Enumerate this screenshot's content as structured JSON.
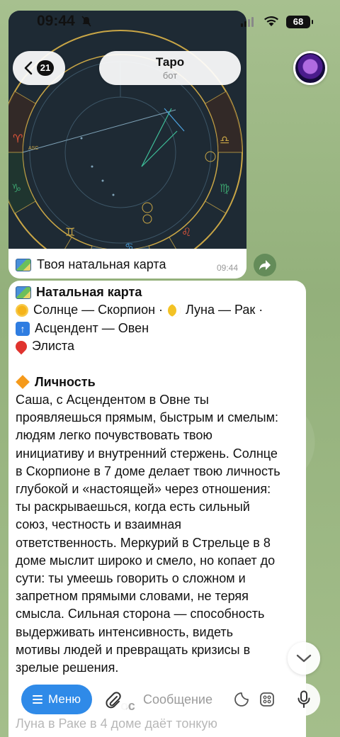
{
  "status": {
    "time": "09:44",
    "battery": "68"
  },
  "header": {
    "back_count": "21",
    "title": "Таро",
    "subtitle": "бот"
  },
  "image_message": {
    "caption": "Твоя натальная карта",
    "time": "09:44",
    "chart_labels": {
      "asc": "ASC"
    }
  },
  "text_message": {
    "heading": "Натальная карта",
    "sun_text": "Солнце — Скорпион ·",
    "moon_text": "Луна — Рак ·",
    "asc_text": "Асцендент — Овен",
    "city": "Элиста",
    "section_title": "Личность",
    "paragraph_lines": [
      "Саша, с Асцендентом в Овне ты",
      "проявляешься прямым, быстрым и смелым:",
      "людям легко почувствовать твою",
      "инициативу и внутренний стержень. Солнце",
      "в Скорпионе в 7 доме делает твою личность",
      "глубокой и «настоящей» через отношения:",
      "ты раскрываешься, когда есть сильный",
      "союз, честность и взаимная",
      "ответственность. Меркурий в Стрельце в 8",
      "доме мыслит широко и смело, но копает до",
      "сути: ты умеешь говорить о сложном и",
      "запретном прямыми словами, не теряя",
      "смысла. Сильная сторона — способность",
      "выдерживать интенсивность, видеть",
      "мотивы людей и превращать кризисы в",
      "зрелые решения."
    ],
    "faded_heading_fragment": "ос",
    "faded_line": "Луна в Раке в 4 доме даёт тонкую"
  },
  "input_bar": {
    "menu_label": "Меню",
    "placeholder": "Сообщение"
  },
  "colors": {
    "accent": "#2f8ae8",
    "chat_bg": "#9fba86",
    "chart_ring": "#c9a646"
  },
  "icons": [
    "chevron-left-icon",
    "paperclip-icon",
    "sticker-icon",
    "emoji-icon",
    "microphone-icon",
    "forward-arrow-icon",
    "chevron-down-icon",
    "mute-icon",
    "wifi-icon"
  ]
}
